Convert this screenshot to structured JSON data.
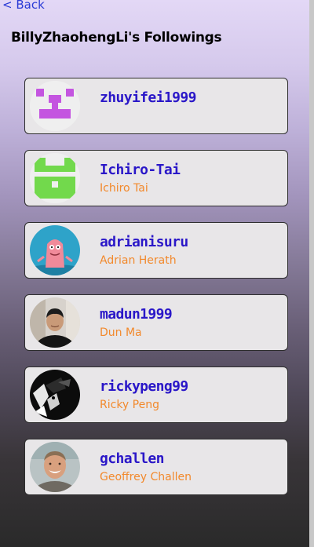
{
  "nav": {
    "back_label": "< Back"
  },
  "page": {
    "title": "BillyZhaohengLi's Followings"
  },
  "users": [
    {
      "username": "zhuyifei1999",
      "full_name": "",
      "avatar": "identicon-purple"
    },
    {
      "username": "Ichiro-Tai",
      "full_name": "Ichiro Tai",
      "avatar": "identicon-green"
    },
    {
      "username": "adrianisuru",
      "full_name": "Adrian Herath",
      "avatar": "cartoon-pink-character"
    },
    {
      "username": "madun1999",
      "full_name": "Dun Ma",
      "avatar": "portrait-photo"
    },
    {
      "username": "rickypeng99",
      "full_name": "Ricky Peng",
      "avatar": "anime-bw-portrait"
    },
    {
      "username": "gchallen",
      "full_name": "Geoffrey Challen",
      "avatar": "portrait-photo-smiling"
    }
  ],
  "colors": {
    "username": "#2a17c8",
    "full_name": "#f2892c",
    "card_background": "#e8e6e8",
    "link": "#2a3bd6"
  }
}
